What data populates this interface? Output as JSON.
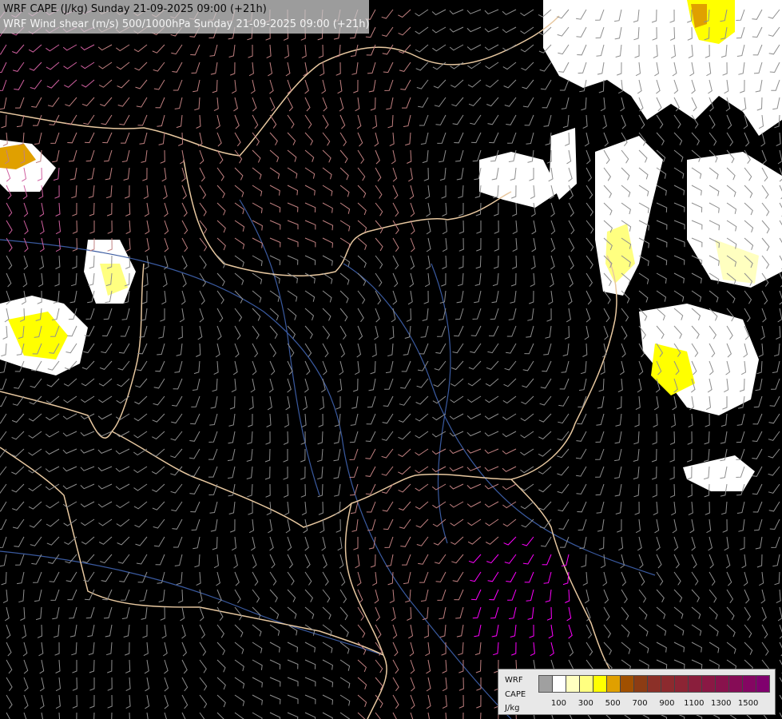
{
  "header": {
    "line1": "WRF CAPE (J/kg) Sunday 21-09-2025 09:00 (+21h)",
    "line2": "WRF Wind shear (m/s) 500/1000hPa Sunday 21-09-2025 09:00 (+21h)"
  },
  "legend": {
    "label_line1": "WRF",
    "label_line2": "CAPE",
    "label_line3": "J/kg",
    "colors": [
      "#a0a0a0",
      "#ffffff",
      "#ffffc0",
      "#ffff80",
      "#ffff00",
      "#e0a000",
      "#a05000",
      "#8c3c14",
      "#8c3028",
      "#8c2a2e",
      "#8c2434",
      "#8a1e3c",
      "#8a1844",
      "#88124c",
      "#860c56",
      "#840662",
      "#80006e"
    ],
    "ticks": [
      "100",
      "300",
      "500",
      "700",
      "900",
      "1100",
      "1300",
      "1500"
    ]
  },
  "map": {
    "background": "#000000",
    "border_color": "#e8c8a0",
    "river_color": "#3a5aa0",
    "barb_colors": {
      "weak": "#8e8e8e",
      "moderate": "#c08080",
      "strong": "#d060a0",
      "very_strong": "#ff00ff"
    }
  }
}
